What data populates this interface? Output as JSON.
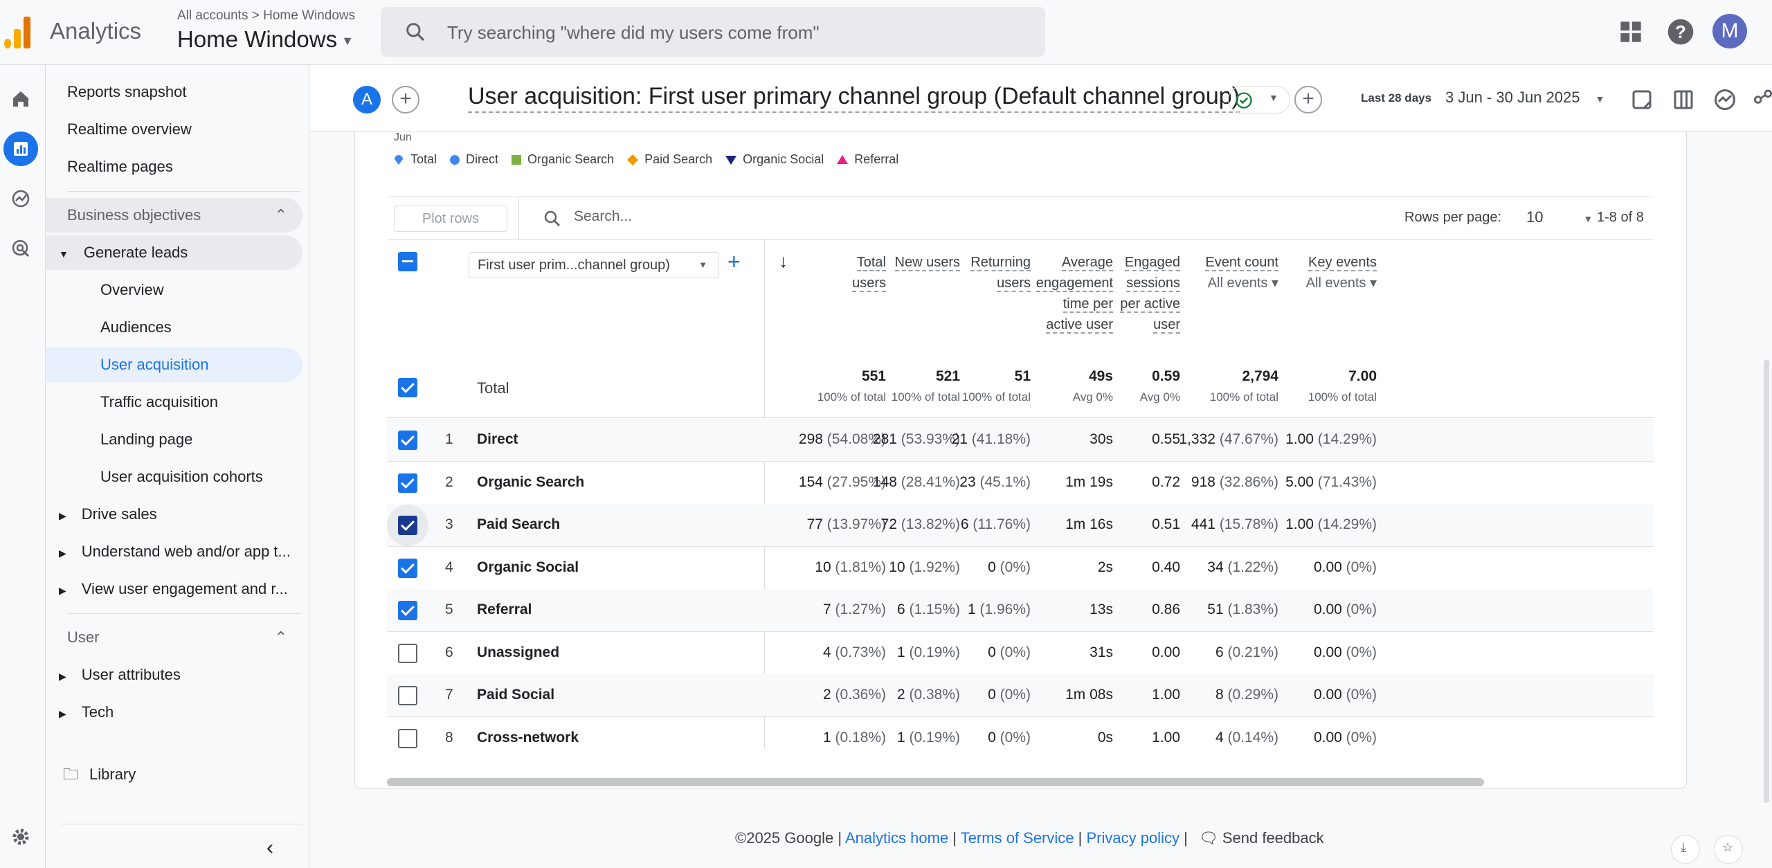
{
  "app": {
    "name": "Analytics"
  },
  "account": {
    "crumbs": "All accounts > Home Windows",
    "name": "Home Windows"
  },
  "search": {
    "placeholder": "Try searching \"where did my users come from\""
  },
  "user": {
    "initial": "M"
  },
  "nav": {
    "top_items": [
      "Reports snapshot",
      "Realtime overview",
      "Realtime pages"
    ],
    "section1": "Business objectives",
    "group": "Generate leads",
    "sub_items": [
      "Overview",
      "Audiences",
      "User acquisition",
      "Traffic acquisition",
      "Landing page",
      "User acquisition cohorts"
    ],
    "collapsed": [
      "Drive sales",
      "Understand web and/or app t...",
      "View user engagement and r..."
    ],
    "section2": "User",
    "user_items": [
      "User attributes",
      "Tech"
    ],
    "library": "Library"
  },
  "report": {
    "comparison_letter": "A",
    "title": "User acquisition: First user primary channel group (Default channel group)",
    "date_label": "Last 28 days",
    "date_range": "3 Jun - 30 Jun 2025"
  },
  "chart_axis_tick": "Jun",
  "legend": [
    {
      "name": "Total",
      "color": "#4285f4",
      "shape": "pin"
    },
    {
      "name": "Direct",
      "color": "#4285f4",
      "shape": "circle"
    },
    {
      "name": "Organic Search",
      "color": "#7cb342",
      "shape": "square"
    },
    {
      "name": "Paid Search",
      "color": "#f29900",
      "shape": "diamond"
    },
    {
      "name": "Organic Social",
      "color": "#1a237e",
      "shape": "triangle-down"
    },
    {
      "name": "Referral",
      "color": "#e91e8c",
      "shape": "triangle-up"
    }
  ],
  "toolbar": {
    "plot_rows": "Plot rows",
    "search_placeholder": "Search...",
    "rows_per_page_label": "Rows per page:",
    "rows_per_page": "10",
    "pager": "1-8 of 8"
  },
  "table": {
    "dimension": "First user prim...channel group)",
    "headers": [
      {
        "lines": [
          "Total",
          "users"
        ],
        "sub": ""
      },
      {
        "lines": [
          "New users"
        ],
        "sub": ""
      },
      {
        "lines": [
          "Returning",
          "users"
        ],
        "sub": ""
      },
      {
        "lines": [
          "Average",
          "engagement",
          "time per",
          "active user"
        ],
        "sub": ""
      },
      {
        "lines": [
          "Engaged",
          "sessions",
          "per active",
          "user"
        ],
        "sub": ""
      },
      {
        "lines": [
          "Event count"
        ],
        "sub": "All events"
      },
      {
        "lines": [
          "Key events"
        ],
        "sub": "All events"
      }
    ],
    "total_label": "Total",
    "totals": [
      {
        "v": "551",
        "p": "100% of total"
      },
      {
        "v": "521",
        "p": "100% of total"
      },
      {
        "v": "51",
        "p": "100% of total"
      },
      {
        "v": "49s",
        "p": "Avg 0%"
      },
      {
        "v": "0.59",
        "p": "Avg 0%"
      },
      {
        "v": "2,794",
        "p": "100% of total"
      },
      {
        "v": "7.00",
        "p": "100% of total"
      }
    ],
    "rows": [
      {
        "n": "1",
        "label": "Direct",
        "checked": true,
        "cells": [
          [
            "298",
            "(54.08%)"
          ],
          [
            "281",
            "(53.93%)"
          ],
          [
            "21",
            "(41.18%)"
          ],
          [
            "30s",
            ""
          ],
          [
            "0.55",
            ""
          ],
          [
            "1,332",
            "(47.67%)"
          ],
          [
            "1.00",
            "(14.29%)"
          ]
        ]
      },
      {
        "n": "2",
        "label": "Organic Search",
        "checked": true,
        "cells": [
          [
            "154",
            "(27.95%)"
          ],
          [
            "148",
            "(28.41%)"
          ],
          [
            "23",
            "(45.1%)"
          ],
          [
            "1m 19s",
            ""
          ],
          [
            "0.72",
            ""
          ],
          [
            "918",
            "(32.86%)"
          ],
          [
            "5.00",
            "(71.43%)"
          ]
        ]
      },
      {
        "n": "3",
        "label": "Paid Search",
        "checked": true,
        "cells": [
          [
            "77",
            "(13.97%)"
          ],
          [
            "72",
            "(13.82%)"
          ],
          [
            "6",
            "(11.76%)"
          ],
          [
            "1m 16s",
            ""
          ],
          [
            "0.51",
            ""
          ],
          [
            "441",
            "(15.78%)"
          ],
          [
            "1.00",
            "(14.29%)"
          ]
        ]
      },
      {
        "n": "4",
        "label": "Organic Social",
        "checked": true,
        "cells": [
          [
            "10",
            "(1.81%)"
          ],
          [
            "10",
            "(1.92%)"
          ],
          [
            "0",
            "(0%)"
          ],
          [
            "2s",
            ""
          ],
          [
            "0.40",
            ""
          ],
          [
            "34",
            "(1.22%)"
          ],
          [
            "0.00",
            "(0%)"
          ]
        ]
      },
      {
        "n": "5",
        "label": "Referral",
        "checked": true,
        "cells": [
          [
            "7",
            "(1.27%)"
          ],
          [
            "6",
            "(1.15%)"
          ],
          [
            "1",
            "(1.96%)"
          ],
          [
            "13s",
            ""
          ],
          [
            "0.86",
            ""
          ],
          [
            "51",
            "(1.83%)"
          ],
          [
            "0.00",
            "(0%)"
          ]
        ]
      },
      {
        "n": "6",
        "label": "Unassigned",
        "checked": false,
        "cells": [
          [
            "4",
            "(0.73%)"
          ],
          [
            "1",
            "(0.19%)"
          ],
          [
            "0",
            "(0%)"
          ],
          [
            "31s",
            ""
          ],
          [
            "0.00",
            ""
          ],
          [
            "6",
            "(0.21%)"
          ],
          [
            "0.00",
            "(0%)"
          ]
        ]
      },
      {
        "n": "7",
        "label": "Paid Social",
        "checked": false,
        "cells": [
          [
            "2",
            "(0.36%)"
          ],
          [
            "2",
            "(0.38%)"
          ],
          [
            "0",
            "(0%)"
          ],
          [
            "1m 08s",
            ""
          ],
          [
            "1.00",
            ""
          ],
          [
            "8",
            "(0.29%)"
          ],
          [
            "0.00",
            "(0%)"
          ]
        ]
      },
      {
        "n": "8",
        "label": "Cross-network",
        "checked": false,
        "cells": [
          [
            "1",
            "(0.18%)"
          ],
          [
            "1",
            "(0.19%)"
          ],
          [
            "0",
            "(0%)"
          ],
          [
            "0s",
            ""
          ],
          [
            "1.00",
            ""
          ],
          [
            "4",
            "(0.14%)"
          ],
          [
            "0.00",
            "(0%)"
          ]
        ]
      }
    ]
  },
  "footer": {
    "copyright": "©2025 Google |",
    "links": [
      "Analytics home",
      "Terms of Service",
      "Privacy policy"
    ],
    "feedback": "Send feedback"
  }
}
